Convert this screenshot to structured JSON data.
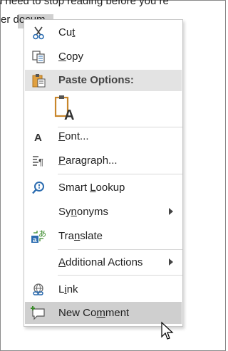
{
  "document": {
    "line1": "u need to stop reading before you re",
    "line2_pre": "er d",
    "line2_sel": "ocum"
  },
  "menu": {
    "cut": {
      "pre": "Cu",
      "ul": "t",
      "post": ""
    },
    "copy": {
      "pre": "",
      "ul": "C",
      "post": "opy"
    },
    "paste_header": "Paste Options:",
    "font": {
      "pre": "",
      "ul": "F",
      "post": "ont..."
    },
    "paragraph": {
      "pre": "",
      "ul": "P",
      "post": "aragraph..."
    },
    "smart_lookup": {
      "pre": "Smart ",
      "ul": "L",
      "post": "ookup"
    },
    "synonyms": {
      "pre": "Sy",
      "ul": "n",
      "post": "onyms"
    },
    "translate": {
      "pre": "Tra",
      "ul": "n",
      "post": "slate"
    },
    "additional_actions": {
      "pre": "",
      "ul": "A",
      "post": "dditional Actions"
    },
    "link": {
      "pre": "L",
      "ul": "i",
      "post": "nk"
    },
    "new_comment": {
      "pre": "New Co",
      "ul": "m",
      "post": "ment"
    }
  },
  "icons": {
    "cut": "scissors-icon",
    "copy": "copy-icon",
    "paste": "clipboard-icon",
    "paste_keep_text": "paste-keep-text-only-icon",
    "font": "font-icon",
    "paragraph": "paragraph-icon",
    "smart_lookup": "search-icon",
    "translate": "translate-icon",
    "link": "link-icon",
    "new_comment": "new-comment-icon",
    "cursor": "mouse-pointer-icon"
  },
  "colors": {
    "accent_blue": "#2b6cb0",
    "header_bg": "#e3e3e3",
    "hover_bg": "#cfcfcf",
    "clipboard_orange": "#c8862a",
    "translate_green": "#3a8a2a"
  }
}
